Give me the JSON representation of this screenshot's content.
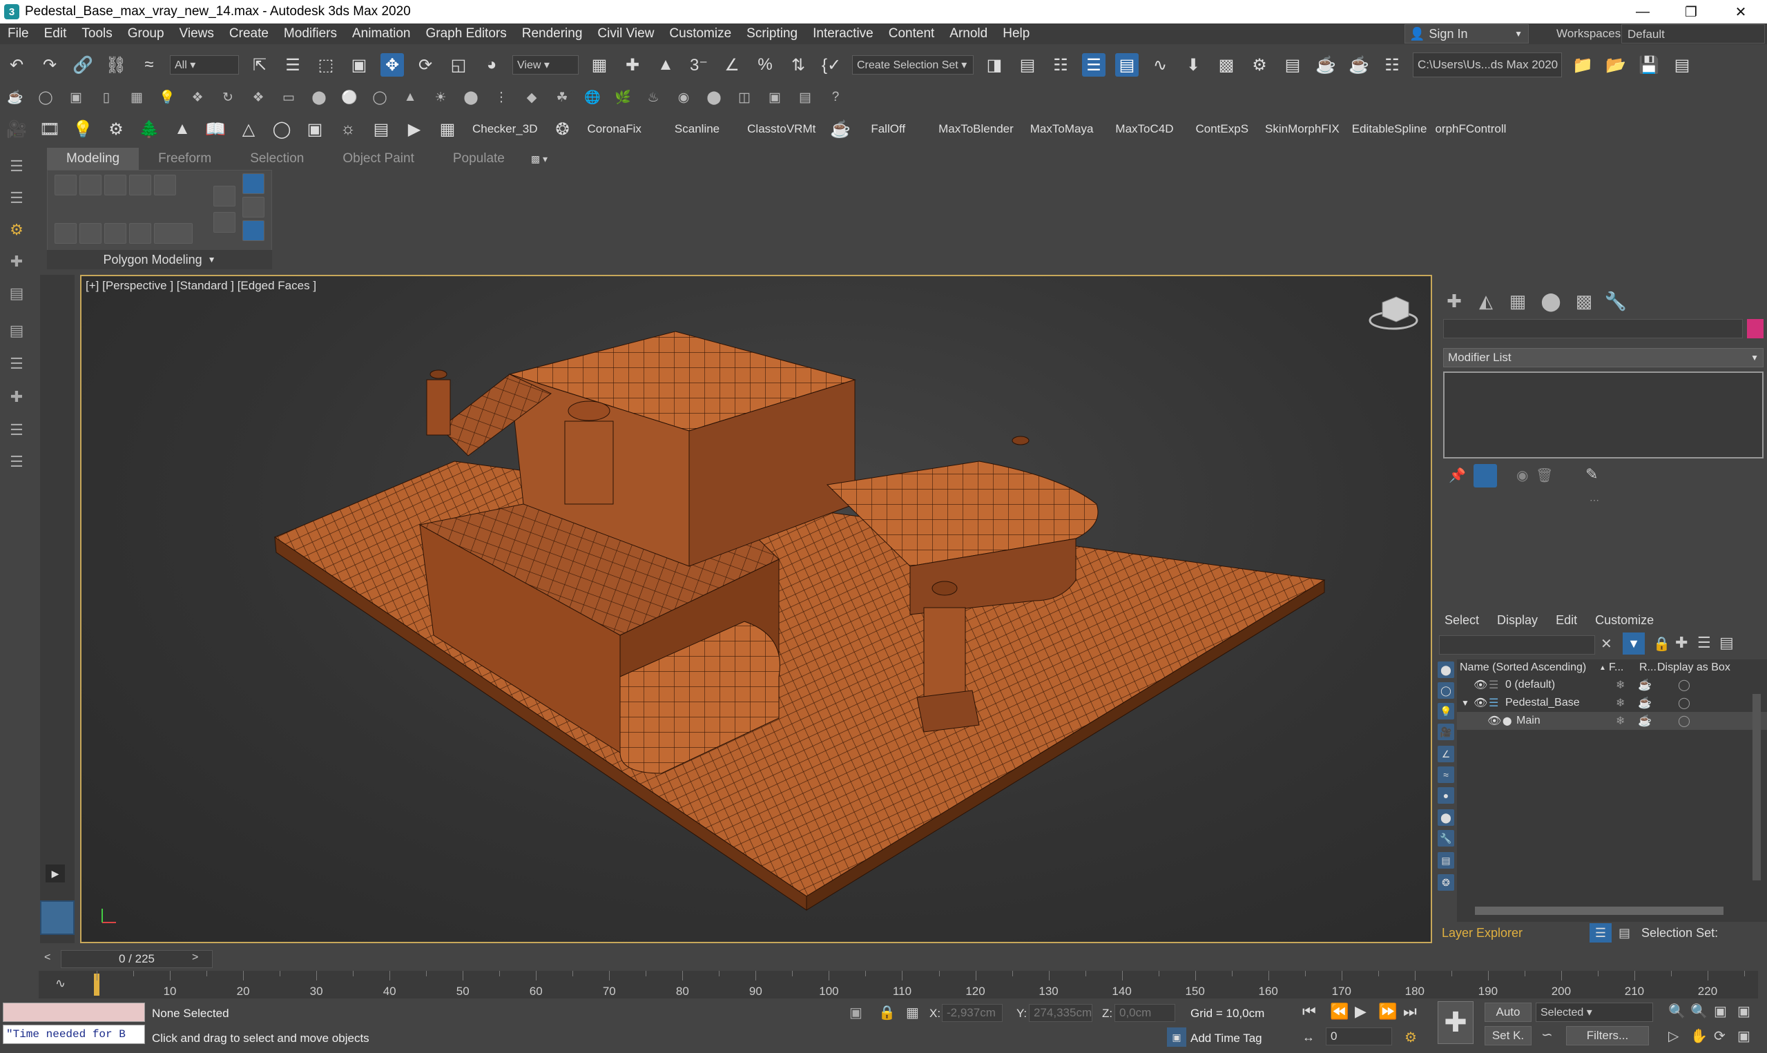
{
  "window": {
    "title": "Pedestal_Base_max_vray_new_14.max - Autodesk 3ds Max 2020",
    "icon": "3"
  },
  "menu": [
    "File",
    "Edit",
    "Tools",
    "Group",
    "Views",
    "Create",
    "Modifiers",
    "Animation",
    "Graph Editors",
    "Rendering",
    "Civil View",
    "Customize",
    "Scripting",
    "Interactive",
    "Content",
    "Arnold",
    "Help"
  ],
  "account": {
    "sign_in": "Sign In",
    "workspaces_label": "Workspaces:",
    "workspace_value": "Default"
  },
  "toolbar": {
    "filter_value": "All",
    "refcoord_value": "View",
    "selection_set_placeholder": "Create Selection Set",
    "project_path": "C:\\Users\\Us...ds Max 2020"
  },
  "plugins": [
    "Checker_3D",
    "CoronaFix",
    "Scanline",
    "ClasstoVRMt",
    "FallOff",
    "MaxToBlender",
    "MaxToMaya",
    "MaxToC4D",
    "ContExpS",
    "SkinMorphFIX",
    "EditableSpline",
    "orphFControll"
  ],
  "ribbon": {
    "tabs": [
      "Modeling",
      "Freeform",
      "Selection",
      "Object Paint",
      "Populate"
    ],
    "active_tab": "Modeling",
    "panel_label": "Polygon Modeling"
  },
  "viewport": {
    "label": "[+] [Perspective ] [Standard ] [Edged Faces ]",
    "mesh_color": "#b8632f",
    "wire_color": "#3a1a08"
  },
  "command_panel": {
    "modifier_list_label": "Modifier List",
    "color_swatch": "#d1307a"
  },
  "scene_explorer": {
    "tabs": [
      "Select",
      "Display",
      "Edit",
      "Customize"
    ],
    "columns": [
      "Name (Sorted Ascending)",
      "F...",
      "R...",
      "Display as Box"
    ],
    "rows": [
      {
        "name": "0 (default)",
        "indent": 0
      },
      {
        "name": "Pedestal_Base",
        "indent": 0
      },
      {
        "name": "Main",
        "indent": 1
      }
    ],
    "footer_label": "Layer Explorer",
    "selection_set_label": "Selection Set:"
  },
  "timeline": {
    "frame_readout": "0 / 225",
    "ticks": [
      10,
      20,
      30,
      40,
      50,
      60,
      70,
      80,
      90,
      100,
      110,
      120,
      130,
      140,
      150,
      160,
      170,
      180,
      190,
      200,
      210,
      220
    ],
    "max_frame": 225
  },
  "status": {
    "selection": "None Selected",
    "prompt": "Click and drag to select and move objects",
    "script_line": "\"Time needed for B",
    "x_label": "X:",
    "x_value": "-2,937cm",
    "y_label": "Y:",
    "y_value": "274,335cm",
    "z_label": "Z:",
    "z_value": "0,0cm",
    "grid": "Grid = 10,0cm",
    "add_time_tag": "Add Time Tag",
    "auto_key": "Auto",
    "set_key": "Set K.",
    "key_filter_value": "Selected",
    "filters": "Filters...",
    "current_frame": "0"
  }
}
